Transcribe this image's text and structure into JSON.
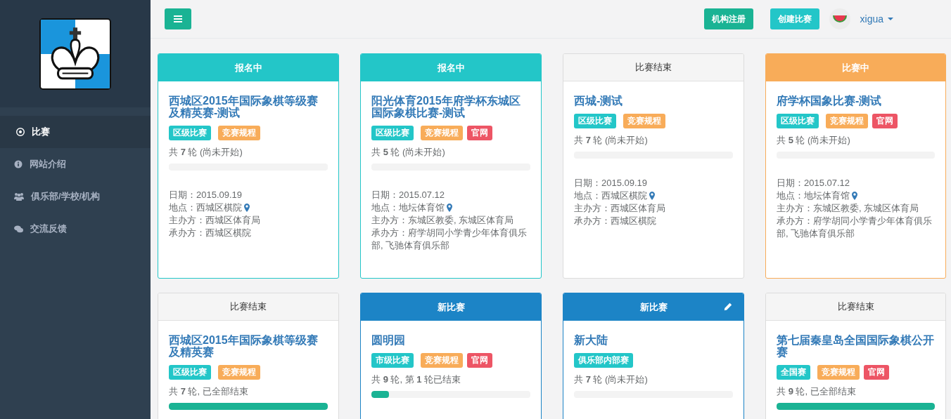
{
  "sidebar": {
    "items": [
      {
        "label": "比赛",
        "selected": true
      },
      {
        "label": "网站介绍",
        "selected": false
      },
      {
        "label": "俱乐部/学校/机构",
        "selected": false
      },
      {
        "label": "交流反馈",
        "selected": false
      }
    ]
  },
  "topbar": {
    "buttons": [
      {
        "label": "机构注册",
        "kind": "green"
      },
      {
        "label": "创建比赛",
        "kind": "teal"
      }
    ],
    "user": "xigua"
  },
  "cards": [
    {
      "status": "报名中",
      "kind": "signup",
      "editable": false,
      "title": "西城区2015年国际象棋等级赛及精英赛-测试",
      "tags": [
        {
          "label": "区级比赛",
          "kind": "level"
        },
        {
          "label": "竞赛规程",
          "kind": "rules"
        }
      ],
      "rounds": "共 **7** 轮 (尚未开始)",
      "level": 0,
      "info": [
        {
          "text": "日期：2015.09.19",
          "pin": false
        },
        {
          "text": "地点：西城区棋院",
          "pin": true
        },
        {
          "text": "主办方：西城区体育局",
          "pin": false
        },
        {
          "text": "承办方：西城区棋院",
          "pin": false
        }
      ]
    },
    {
      "status": "报名中",
      "kind": "signup",
      "editable": false,
      "title": "阳光体育2015年府学杯东城区国际象棋比赛-测试",
      "tags": [
        {
          "label": "区级比赛",
          "kind": "level"
        },
        {
          "label": "竞赛规程",
          "kind": "rules"
        },
        {
          "label": "官网",
          "kind": "site"
        }
      ],
      "rounds": "共 **5** 轮 (尚未开始)",
      "level": 0,
      "info": [
        {
          "text": "日期：2015.07.12",
          "pin": false
        },
        {
          "text": "地点：地坛体育馆",
          "pin": true
        },
        {
          "text": "主办方：东城区教委, 东城区体育局",
          "pin": false
        },
        {
          "text": "承办方：府学胡同小学青少年体育俱乐部, 飞驰体育俱乐部",
          "pin": false
        }
      ]
    },
    {
      "status": "比赛结束",
      "kind": "ended",
      "editable": false,
      "title": "西城-测试",
      "tags": [
        {
          "label": "区级比赛",
          "kind": "level"
        },
        {
          "label": "竞赛规程",
          "kind": "rules"
        }
      ],
      "rounds": "共 **7** 轮 (尚未开始)",
      "level": 0,
      "info": [
        {
          "text": "日期：2015.09.19",
          "pin": false
        },
        {
          "text": "地点：西城区棋院",
          "pin": true
        },
        {
          "text": "主办方：西城区体育局",
          "pin": false
        },
        {
          "text": "承办方：西城区棋院",
          "pin": false
        }
      ]
    },
    {
      "status": "比赛中",
      "kind": "ongoing",
      "editable": false,
      "title": "府学杯国象比赛-测试",
      "tags": [
        {
          "label": "区级比赛",
          "kind": "level"
        },
        {
          "label": "竞赛规程",
          "kind": "rules"
        },
        {
          "label": "官网",
          "kind": "site"
        }
      ],
      "rounds": "共 **5** 轮 (尚未开始)",
      "level": 0,
      "info": [
        {
          "text": "日期：2015.07.12",
          "pin": false
        },
        {
          "text": "地点：地坛体育馆",
          "pin": true
        },
        {
          "text": "主办方：东城区教委, 东城区体育局",
          "pin": false
        },
        {
          "text": "承办方：府学胡同小学青少年体育俱乐部, 飞驰体育俱乐部",
          "pin": false
        }
      ]
    },
    {
      "status": "比赛结束",
      "kind": "ended",
      "editable": false,
      "title": "西城区2015年国际象棋等级赛及精英赛",
      "tags": [
        {
          "label": "区级比赛",
          "kind": "level"
        },
        {
          "label": "竞赛规程",
          "kind": "rules"
        }
      ],
      "rounds": "共 **7** 轮, 已全部结束",
      "level": 1
    },
    {
      "status": "新比赛",
      "kind": "new",
      "editable": false,
      "title": "圆明园",
      "tags": [
        {
          "label": "市级比赛",
          "kind": "level"
        },
        {
          "label": "竞赛规程",
          "kind": "rules"
        },
        {
          "label": "官网",
          "kind": "site"
        }
      ],
      "rounds": "共 **9** 轮, 第 **1** 轮已结束",
      "level": 0.11
    },
    {
      "status": "新比赛",
      "kind": "new",
      "editable": true,
      "title": "新大陆",
      "tags": [
        {
          "label": "俱乐部内部赛",
          "kind": "level"
        }
      ],
      "rounds": "共 **7** 轮 (尚未开始)",
      "level": 0
    },
    {
      "status": "比赛结束",
      "kind": "ended",
      "editable": false,
      "title": "第七届秦皇岛全国国际象棋公开赛",
      "tags": [
        {
          "label": "全国赛",
          "kind": "level"
        },
        {
          "label": "竞赛规程",
          "kind": "rules"
        },
        {
          "label": "官网",
          "kind": "site"
        }
      ],
      "rounds": "共 **9** 轮, 已全部结束",
      "level": 1
    }
  ]
}
